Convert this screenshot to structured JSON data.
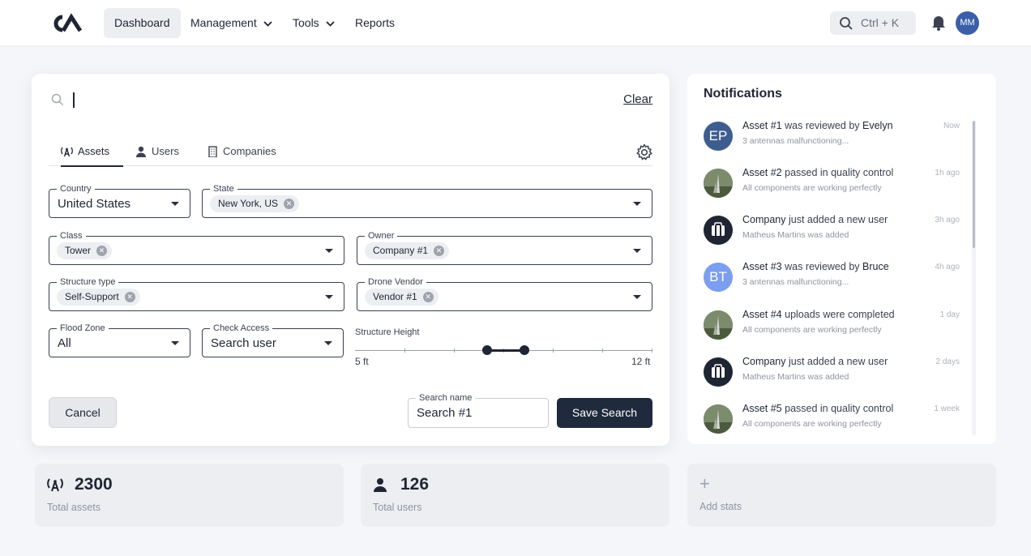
{
  "nav": {
    "logo": "CA",
    "items": [
      {
        "label": "Dashboard",
        "dropdown": false,
        "active": true
      },
      {
        "label": "Management",
        "dropdown": true
      },
      {
        "label": "Tools",
        "dropdown": true
      },
      {
        "label": "Reports",
        "dropdown": false
      }
    ],
    "search_shortcut": "Ctrl + K",
    "avatar_initials": "MM"
  },
  "search": {
    "query": "",
    "clear_label": "Clear",
    "tabs": [
      {
        "label": "Assets",
        "icon": "antenna-icon",
        "active": true
      },
      {
        "label": "Users",
        "icon": "user-icon"
      },
      {
        "label": "Companies",
        "icon": "building-icon"
      }
    ],
    "filters": {
      "country": {
        "label": "Country",
        "value": "United States"
      },
      "state": {
        "label": "State",
        "chip": "New York, US"
      },
      "class": {
        "label": "Class",
        "chip": "Tower"
      },
      "owner": {
        "label": "Owner",
        "chip": "Company #1"
      },
      "structure_type": {
        "label": "Structure type",
        "chip": "Self-Support"
      },
      "drone_vendor": {
        "label": "Drone Vendor",
        "chip": "Vendor #1"
      },
      "flood_zone": {
        "label": "Flood Zone",
        "value": "All"
      },
      "check_access": {
        "label": "Check Access",
        "value": "Search user"
      }
    },
    "structure_height": {
      "label": "Structure Height",
      "min_label": "5 ft",
      "max_label": "12 ft"
    },
    "search_name": {
      "label": "Search name",
      "value": "Search #1"
    },
    "cancel_label": "Cancel",
    "save_label": "Save Search"
  },
  "notifications": {
    "title": "Notifications",
    "items": [
      {
        "avatar": "EP",
        "pre": "Asset #1",
        "mid": " was reviewed by ",
        "post": "Evelyn",
        "sub": "3 antennas malfunctioning...",
        "time": "Now",
        "color": "#3e5d8f",
        "kind": "initials"
      },
      {
        "avatar": "",
        "pre": "Asset #2",
        "mid": " passed in quality control",
        "post": "",
        "sub": "All components are working perfectly",
        "time": "1h ago",
        "color": "#5a7350",
        "kind": "photo"
      },
      {
        "avatar": "",
        "pre": "Company",
        "mid": " just added a new user",
        "post": "",
        "sub": "Matheus Martins was added",
        "time": "3h ago",
        "color": "#1f2533",
        "kind": "company"
      },
      {
        "avatar": "BT",
        "pre": "Asset #3",
        "mid": " was reviewed by ",
        "post": "Bruce",
        "sub": "3 antennas malfunctioning...",
        "time": "4h ago",
        "color": "#7b9ef0",
        "kind": "initials"
      },
      {
        "avatar": "",
        "pre": "Asset #4",
        "mid": " uploads were completed",
        "post": "",
        "sub": "All components are working perfectly",
        "time": "1 day",
        "color": "#5a7350",
        "kind": "photo"
      },
      {
        "avatar": "",
        "pre": "Company",
        "mid": " just added a new user",
        "post": "",
        "sub": "Matheus Martins was added",
        "time": "2 days",
        "color": "#1f2533",
        "kind": "company"
      },
      {
        "avatar": "",
        "pre": "Asset #5",
        "mid": " passed in quality control",
        "post": "",
        "sub": "All components are working perfectly",
        "time": "1 week",
        "color": "#5a7350",
        "kind": "photo"
      }
    ]
  },
  "stats": {
    "assets": {
      "value": "2300",
      "caption": "Total assets"
    },
    "users": {
      "value": "126",
      "caption": "Total users"
    },
    "add": {
      "caption": "Add stats"
    }
  },
  "colors": {
    "primary": "#1f2a3c",
    "accent": "#3b5ea8"
  }
}
